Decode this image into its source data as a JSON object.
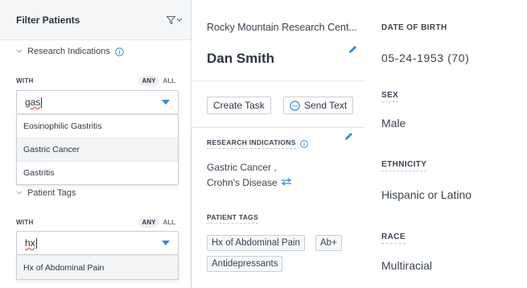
{
  "filter": {
    "title": "Filter Patients",
    "research_indications": {
      "label": "Research Indications",
      "with_label": "WITH",
      "any_label": "ANY",
      "all_label": "ALL",
      "search_value": "gas",
      "options": [
        "Eosinophilic Gastritis",
        "Gastric Cancer",
        "Gastritis"
      ]
    },
    "patient_tags": {
      "label": "Patient Tags",
      "with_label": "WITH",
      "any_label": "ANY",
      "all_label": "ALL",
      "search_value": "hx",
      "options": [
        "Hx of Abdominal Pain"
      ]
    }
  },
  "patient": {
    "site": "Rocky Mountain Research Cent...",
    "name": "Dan Smith",
    "actions": {
      "create_task": "Create Task",
      "send_text": "Send Text"
    },
    "research_indications": {
      "label": "RESEARCH INDICATIONS",
      "line1": "Gastric Cancer  ,",
      "line2": "Crohn's Disease"
    },
    "patient_tags": {
      "label": "PATIENT TAGS",
      "tags": [
        "Hx of Abdominal Pain",
        "Ab+",
        "Antidepressants"
      ]
    }
  },
  "details": {
    "dob_label": "DATE OF BIRTH",
    "dob_value": "05-24-1953 (70)",
    "sex_label": "SEX",
    "sex_value": "Male",
    "ethnicity_label": "ETHNICITY",
    "ethnicity_value": "Hispanic or Latino",
    "race_label": "RACE",
    "race_value": "Multiracial"
  },
  "colors": {
    "accent": "#2d8ce0",
    "text": "#2d3540",
    "border": "#c9cfd6"
  }
}
